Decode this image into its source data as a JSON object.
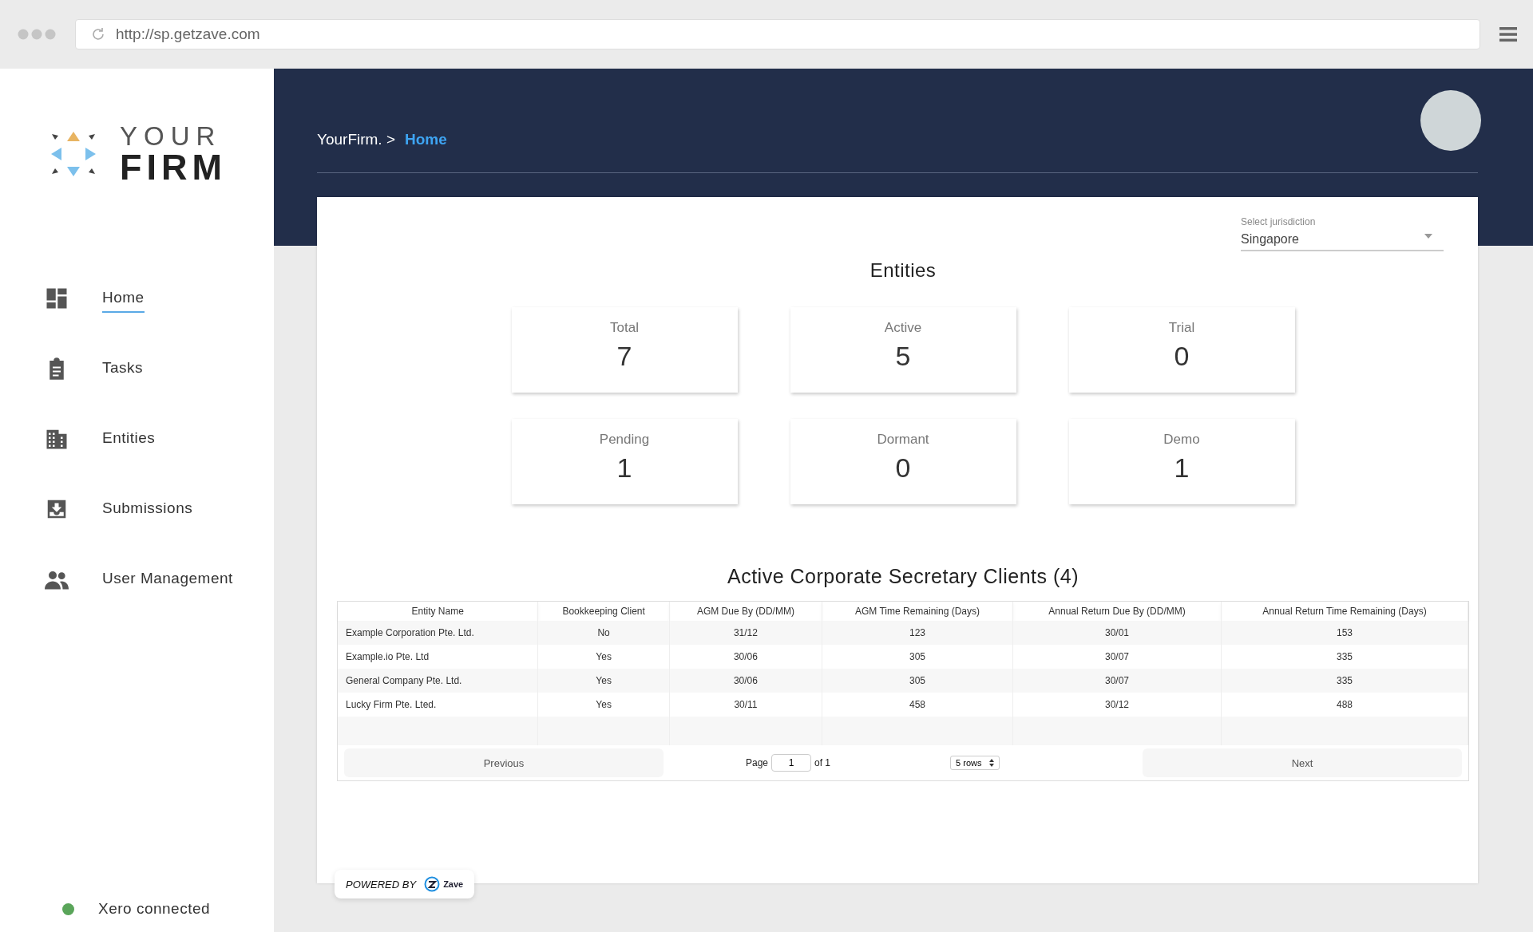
{
  "browser": {
    "url": "http://sp.getzave.com"
  },
  "logo": {
    "line_1": "YOUR",
    "line_2": "FIRM"
  },
  "sidebar": {
    "items": [
      {
        "label": "Home",
        "selected": true
      },
      {
        "label": "Tasks",
        "selected": false
      },
      {
        "label": "Entities",
        "selected": false
      },
      {
        "label": "Submissions",
        "selected": false
      },
      {
        "label": "User Management",
        "selected": false
      }
    ],
    "status": {
      "label": "Xero connected",
      "connected": true
    }
  },
  "header": {
    "breadcrumb": [
      {
        "label": "YourFirm. >",
        "current": false
      },
      {
        "label": "Home",
        "current": true
      }
    ]
  },
  "jurisdiction": {
    "label": "Select jurisdiction",
    "value": "Singapore"
  },
  "entities": {
    "title": "Entities",
    "stats": [
      {
        "label": "Total",
        "value": "7"
      },
      {
        "label": "Active",
        "value": "5"
      },
      {
        "label": "Trial",
        "value": "0"
      },
      {
        "label": "Pending",
        "value": "1"
      },
      {
        "label": "Dormant",
        "value": "0"
      },
      {
        "label": "Demo",
        "value": "1"
      }
    ]
  },
  "clients": {
    "title": "Active Corporate Secretary Clients (4)",
    "columns": [
      "Entity Name",
      "Bookkeeping Client",
      "AGM Due By (DD/MM)",
      "AGM Time Remaining (Days)",
      "Annual Return Due By (DD/MM)",
      "Annual Return Time Remaining (Days)"
    ],
    "rows": [
      [
        "Example Corporation Pte. Ltd.",
        "No",
        "31/12",
        "123",
        "30/01",
        "153"
      ],
      [
        "Example.io Pte. Ltd",
        "Yes",
        "30/06",
        "305",
        "30/07",
        "335"
      ],
      [
        "General Company Pte. Ltd.",
        "Yes",
        "30/06",
        "305",
        "30/07",
        "335"
      ],
      [
        "Lucky Firm Pte. Lted.",
        "Yes",
        "30/11",
        "458",
        "30/12",
        "488"
      ]
    ],
    "pagination": {
      "previous": "Previous",
      "page_label": "Page",
      "page": "1",
      "of": "of 1",
      "rows_select": "5 rows",
      "next": "Next"
    }
  },
  "footer": {
    "powered_by": "POWERED BY",
    "brand": "Zave"
  }
}
